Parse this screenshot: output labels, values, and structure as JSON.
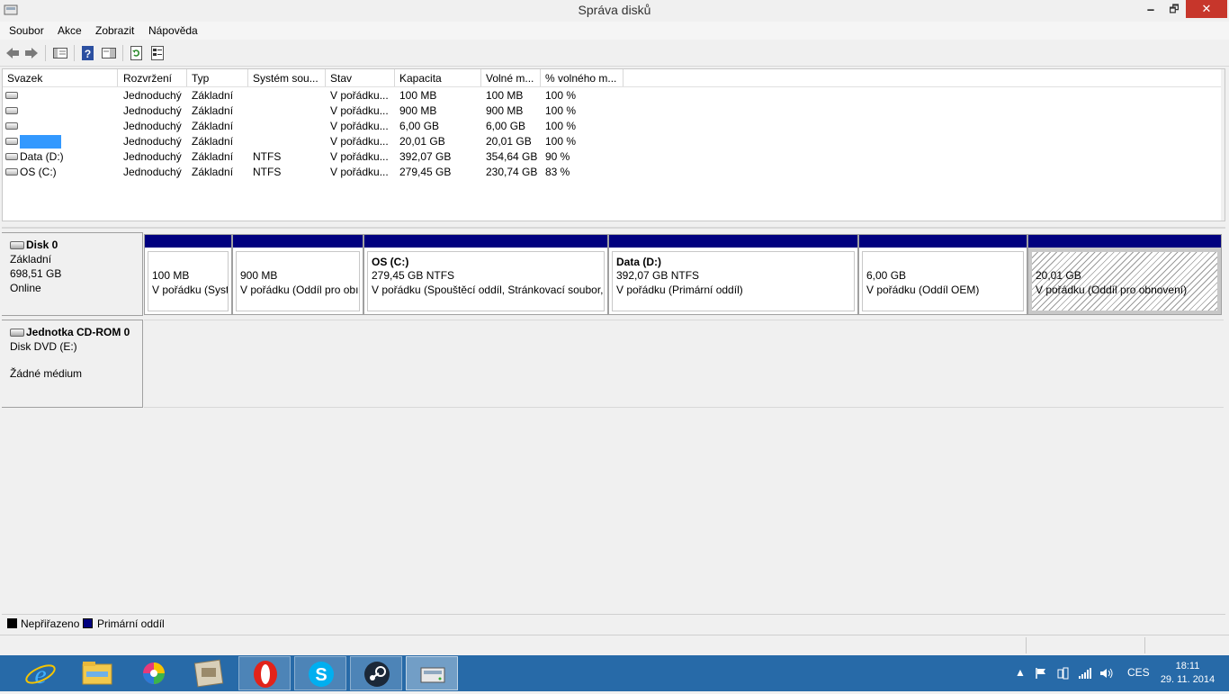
{
  "window": {
    "title": "Správa disků",
    "minimize": "🗕",
    "maximize": "🗗",
    "close": "✕"
  },
  "menu": [
    "Soubor",
    "Akce",
    "Zobrazit",
    "Nápověda"
  ],
  "toolbar": {
    "icons": [
      "back-arrow-icon",
      "forward-arrow-icon",
      "console-tree-icon",
      "help-icon",
      "show-pane-icon",
      "refresh-icon",
      "properties-icon"
    ]
  },
  "volume_list": {
    "columns": [
      "Svazek",
      "Rozvržení",
      "Typ",
      "Systém sou...",
      "Stav",
      "Kapacita",
      "Volné m...",
      "% volného m..."
    ],
    "rows": [
      {
        "name": "",
        "layout": "Jednoduchý",
        "type": "Základní",
        "fs": "",
        "status": "V pořádku...",
        "capacity": "100 MB",
        "free": "100 MB",
        "pct": "100 %"
      },
      {
        "name": "",
        "layout": "Jednoduchý",
        "type": "Základní",
        "fs": "",
        "status": "V pořádku...",
        "capacity": "900 MB",
        "free": "900 MB",
        "pct": "100 %"
      },
      {
        "name": "",
        "layout": "Jednoduchý",
        "type": "Základní",
        "fs": "",
        "status": "V pořádku...",
        "capacity": "6,00 GB",
        "free": "6,00 GB",
        "pct": "100 %"
      },
      {
        "name": "",
        "layout": "Jednoduchý",
        "type": "Základní",
        "fs": "",
        "status": "V pořádku...",
        "capacity": "20,01 GB",
        "free": "20,01 GB",
        "pct": "100 %",
        "selected": true
      },
      {
        "name": "Data (D:)",
        "layout": "Jednoduchý",
        "type": "Základní",
        "fs": "NTFS",
        "status": "V pořádku...",
        "capacity": "392,07 GB",
        "free": "354,64 GB",
        "pct": "90 %"
      },
      {
        "name": "OS (C:)",
        "layout": "Jednoduchý",
        "type": "Základní",
        "fs": "NTFS",
        "status": "V pořádku...",
        "capacity": "279,45 GB",
        "free": "230,74 GB",
        "pct": "83 %"
      }
    ]
  },
  "disk0": {
    "name": "Disk 0",
    "type": "Základní",
    "size": "698,51 GB",
    "status": "Online",
    "partitions": [
      {
        "name": "",
        "size": "100 MB",
        "status": "V pořádku (Syst"
      },
      {
        "name": "",
        "size": "900 MB",
        "status": "V pořádku (Oddíl pro obı"
      },
      {
        "name": "OS  (C:)",
        "size": "279,45 GB NTFS",
        "status": "V pořádku (Spouštěcí oddíl, Stránkovací soubor,"
      },
      {
        "name": "Data  (D:)",
        "size": "392,07 GB NTFS",
        "status": "V pořádku (Primární oddíl)"
      },
      {
        "name": "",
        "size": "6,00 GB",
        "status": "V pořádku (Oddíl OEM)"
      },
      {
        "name": "",
        "size": "20,01 GB",
        "status": "V pořádku (Oddíl pro obnovení)",
        "selected": true
      }
    ]
  },
  "cdrom0": {
    "name": "Jednotka CD-ROM 0",
    "type": "Disk DVD (E:)",
    "status": "Žádné médium"
  },
  "legend": [
    {
      "label": "Nepřiřazeno",
      "color": "#000000"
    },
    {
      "label": "Primární oddíl",
      "color": "#00007f"
    }
  ],
  "taskbar": {
    "apps": [
      "internet-explorer-icon",
      "file-explorer-icon",
      "color-wheel-app-icon",
      "control-panel-icon",
      "opera-icon",
      "skype-icon",
      "steam-icon",
      "disk-management-icon"
    ],
    "tray": {
      "lang": "CES",
      "time": "18:11",
      "date": "29. 11. 2014"
    }
  },
  "colors": {
    "accent_bar": "#00007f",
    "taskbar": "#276aa8",
    "close_button": "#c7362b",
    "selection": "#3399ff"
  }
}
